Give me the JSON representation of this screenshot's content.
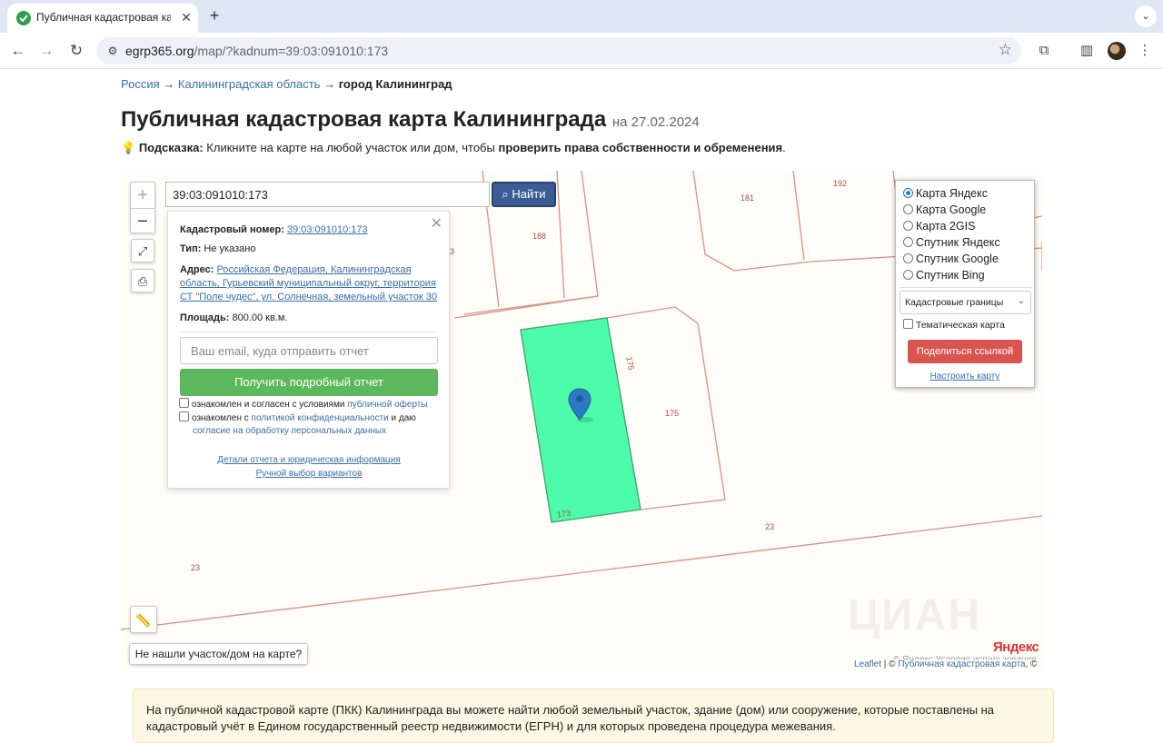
{
  "browser": {
    "tab_title": "Публичная кадастровая карта",
    "url_host": "egrp365.org",
    "url_path": "/map/?kadnum=39:03:091010:173"
  },
  "breadcrumb": {
    "items": [
      "Россия",
      "Калининградская область"
    ],
    "current": "город Калининград",
    "separator": "→"
  },
  "header": {
    "title": "Публичная кадастровая карта Калининграда",
    "date": "на 27.02.2024"
  },
  "hint": {
    "label": "Подсказка:",
    "text": " Кликните на карте на любой участок или дом, чтобы ",
    "bold": "проверить права собственности и обременения",
    "end": "."
  },
  "map": {
    "search_value": "39:03:091010:173",
    "search_button": "Найти",
    "parcel_labels": {
      "p181": "181",
      "p192": "192",
      "p188": "188",
      "p3": "3",
      "p175a": "175",
      "p175b": "175",
      "p173": "173",
      "p23a": "23",
      "p23b": "23"
    },
    "popup": {
      "kadnum_label": "Кадастровый номер:",
      "kadnum_value": "39:03:091010:173",
      "type_label": "Тип:",
      "type_value": " Не указано",
      "address_label": "Адрес:",
      "address_value": "Российская Федерация, Калининградская область, Гурьевский муниципальный округ, территория СТ \"Поле чудес\", ул. Солнечная, земельный участок 30",
      "area_label": "Площадь:",
      "area_value": " 800.00 кв.м.",
      "email_placeholder": "Ваш email, куда отправить отчет",
      "report_button": "Получить подробный отчет",
      "agree1_text": "ознакомлен и согласен с условиями ",
      "agree1_link": "публичной оферты",
      "agree2_text": "ознакомлен с ",
      "agree2_link": "политикой конфиденциальности",
      "agree2_text2": " и даю",
      "agree2_link2": "согласие на обработку персональных данных",
      "details_link": "Детали отчета и юридическая информация",
      "manual_link": "Ручной выбор вариантов"
    },
    "layers": {
      "options": [
        "Карта Яндекс",
        "Карта Google",
        "Карта 2GIS",
        "Спутник Яндекс",
        "Спутник Google",
        "Спутник Bing"
      ],
      "selected": "Карта Яндекс",
      "select_value": "Кадастровые границы",
      "thematic_label": "Тематическая карта",
      "share_button": "Поделиться ссылкой",
      "configure_link": "Настроить карту"
    },
    "not_found_button": "Не нашли участок/дом на карте?",
    "yandex_logo": "Яндекс",
    "yandex_terms": "© Яндекс  Условия использования",
    "attribution_leaflet": "Leaflet",
    "attribution_sep": " | © ",
    "attribution_pkk": "Публичная кадастровая карта",
    "attribution_end": ", ©",
    "watermark": "ЦИАН"
  },
  "info": {
    "text": "На публичной кадастровой карте (ПКК) Калининграда вы можете найти любой земельный участок, здание (дом) или сооружение, которые поставлены на кадастровый учёт в Едином государственный реестр недвижимости (ЕГРН) и для которых проведена процедура межевания."
  },
  "colors": {
    "parcel_fill": "#4dfcaa",
    "parcel_stroke": "#3aa06a",
    "boundary": "#d9918a",
    "accent_blue": "#3b5d94",
    "success": "#5cb85c",
    "danger": "#d9534f"
  }
}
